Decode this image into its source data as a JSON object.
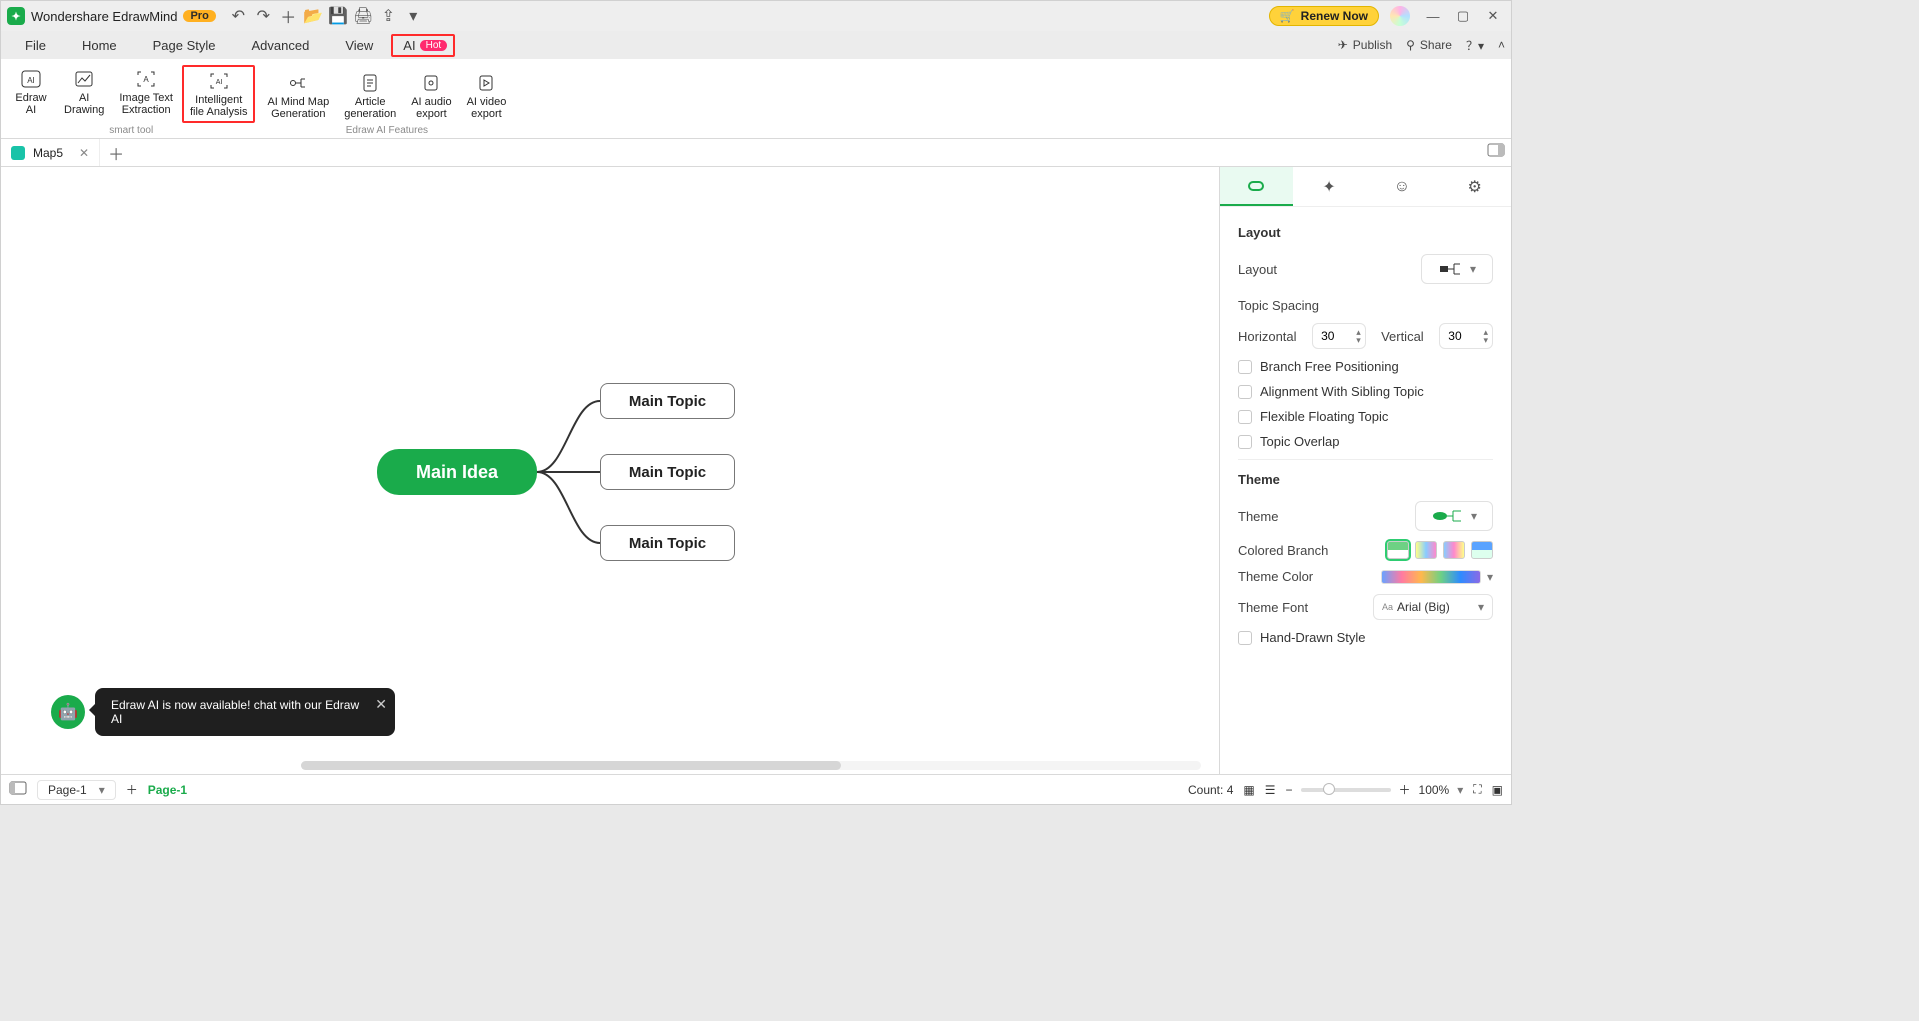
{
  "titlebar": {
    "app": "Wondershare EdrawMind",
    "pro": "Pro",
    "renew": "Renew Now"
  },
  "menu": {
    "items": [
      "File",
      "Home",
      "Page Style",
      "Advanced",
      "View"
    ],
    "ai": "AI",
    "hot": "Hot",
    "publish": "Publish",
    "share": "Share"
  },
  "ribbon": {
    "tools": [
      {
        "l1": "Edraw",
        "l2": "AI"
      },
      {
        "l1": "AI",
        "l2": "Drawing"
      },
      {
        "l1": "Image Text",
        "l2": "Extraction"
      },
      {
        "l1": "Intelligent",
        "l2": "file Analysis"
      },
      {
        "l1": "AI Mind Map",
        "l2": "Generation"
      },
      {
        "l1": "Article",
        "l2": "generation"
      },
      {
        "l1": "AI audio",
        "l2": "export"
      },
      {
        "l1": "AI video",
        "l2": "export"
      }
    ],
    "group1": "smart tool",
    "group2": "Edraw AI Features"
  },
  "doc": {
    "tab": "Map5"
  },
  "mindmap": {
    "main": "Main Idea",
    "topics": [
      "Main Topic",
      "Main Topic",
      "Main Topic"
    ]
  },
  "ai_toast": "Edraw AI is now available!  chat with our Edraw AI",
  "side": {
    "layout_title": "Layout",
    "layout_label": "Layout",
    "spacing_title": "Topic Spacing",
    "horizontal": "Horizontal",
    "horizontal_val": "30",
    "vertical": "Vertical",
    "vertical_val": "30",
    "branch_free": "Branch Free Positioning",
    "align_sibling": "Alignment With Sibling Topic",
    "flexible": "Flexible Floating Topic",
    "overlap": "Topic Overlap",
    "theme_title": "Theme",
    "theme_label": "Theme",
    "colored_branch": "Colored Branch",
    "theme_color": "Theme Color",
    "theme_font": "Theme Font",
    "font_value": "Arial (Big)",
    "hand_drawn": "Hand-Drawn Style"
  },
  "status": {
    "page_label": "Page-1",
    "page_active": "Page-1",
    "count_label": "Count:",
    "count_value": "4",
    "zoom": "100%"
  }
}
